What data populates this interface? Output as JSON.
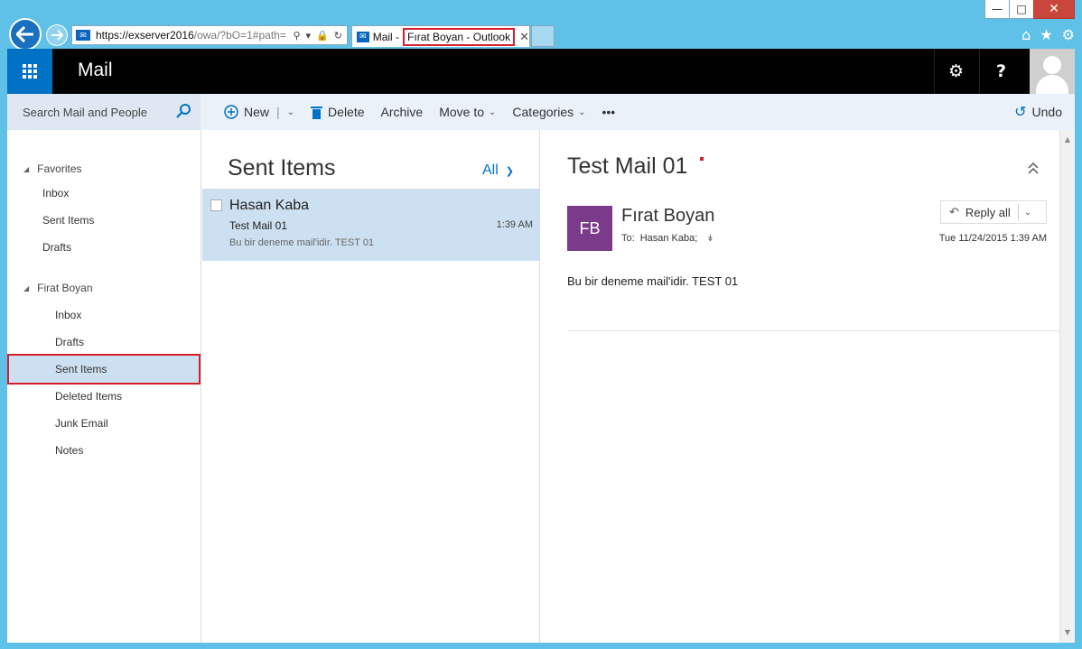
{
  "browser": {
    "address": {
      "proto": "https://",
      "host": "exserver2016",
      "path": "/owa/?bO=1#path="
    },
    "tab": {
      "title_a": "Mail -",
      "title_b": "Fırat Boyan - Outlook"
    }
  },
  "owa": {
    "app_title": "Mail",
    "search_placeholder": "Search Mail and People",
    "commands": {
      "new": "New",
      "delete": "Delete",
      "archive": "Archive",
      "move_to": "Move to",
      "categories": "Categories",
      "more": "•••",
      "undo": "Undo"
    },
    "nav": {
      "favorites_label": "Favorites",
      "favorites": [
        "Inbox",
        "Sent Items",
        "Drafts"
      ],
      "account_label": "Firat Boyan",
      "account_folders": [
        "Inbox",
        "Drafts",
        "Sent Items",
        "Deleted Items",
        "Junk Email",
        "Notes"
      ],
      "selected": "Sent Items"
    },
    "list": {
      "title": "Sent Items",
      "filter": "All",
      "messages": [
        {
          "sender": "Hasan Kaba",
          "subject": "Test Mail 01",
          "time": "1:39 AM",
          "preview": "Bu bir deneme mail'idir. TEST 01"
        }
      ]
    },
    "reading": {
      "subject": "Test Mail 01",
      "avatar_initials": "FB",
      "from": "Fırat Boyan",
      "to_label": "To:",
      "to": "Hasan Kaba;",
      "reply_label": "Reply all",
      "date": "Tue 11/24/2015 1:39 AM",
      "body": "Bu bir deneme mail'idir. TEST 01"
    }
  },
  "colors": {
    "accent": "#0072c6",
    "highlight": "#d4202b",
    "selected_bg": "#cde0f1",
    "avatar_bg": "#7a3b8a"
  }
}
